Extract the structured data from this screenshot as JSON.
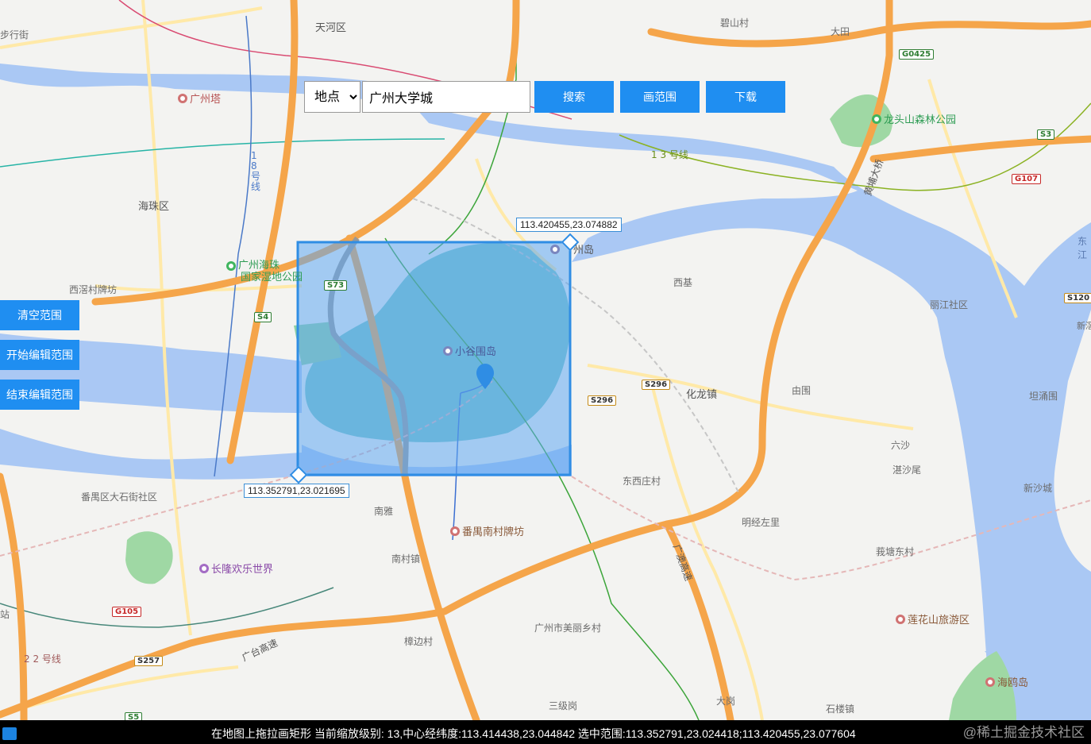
{
  "search": {
    "type_selected": "地点",
    "type_options": [
      "地点"
    ],
    "query_value": "广州大学城",
    "search_label": "搜索",
    "draw_label": "画范围",
    "download_label": "下载"
  },
  "side_buttons": {
    "clear_label": "清空范围",
    "start_edit_label": "开始编辑范围",
    "end_edit_label": "结束编辑范围"
  },
  "selection": {
    "ne_label": "113.420455,23.074882",
    "sw_label": "113.352791,23.021695"
  },
  "status": {
    "text": "在地图上拖拉画矩形 当前缩放级别: 13,中心经纬度:113.414438,23.044842 选中范围:113.352791,23.024418;113.420455,23.077604",
    "watermark": "@稀土掘金技术社区"
  },
  "map": {
    "places": {
      "tianhe": "天河区",
      "bishancun": "碧山村",
      "datian": "大田",
      "buxingjie": "步行街",
      "haizhu": "海珠区",
      "xiqiao": "西滘村牌坊",
      "xiji": "西基",
      "lijiang": "丽江社区",
      "huachong": "化龙镇",
      "youwei": "由围",
      "tanyong": "坦涌围",
      "liusha": "六沙",
      "zhansha": "湛沙尾",
      "xinshacheng": "新沙城",
      "dongxi": "东西庄村",
      "mingjing": "明经左里",
      "yichang": "莪塘东村",
      "panyu_dashi": "番禺区大石街社区",
      "nanya": "南雅",
      "nancun": "南村镇",
      "zhangbian": "樟边村",
      "meili": "广州市美丽乡村",
      "sanji": "三级岗",
      "dagang": "大岗",
      "shilou": "石楼镇",
      "zhan": "站",
      "nanbu": "新滘"
    },
    "pois": {
      "canton_tower": "广州塔",
      "wetland_1": "广州海珠",
      "wetland_2": "国家湿地公园",
      "xiaoguwei": "小谷围岛",
      "pazhou": "州岛",
      "longtou": "龙头山森林公园",
      "nancun_gate": "番禺南村牌坊",
      "changlong": "长隆欢乐世界",
      "lianhua": "莲花山旅游区",
      "haiou": "海鸥岛"
    },
    "roads": {
      "s73": "S73",
      "s4": "S4",
      "s296a": "S296",
      "s296b": "S296",
      "s3": "S3",
      "g0425": "G0425",
      "g107": "G107",
      "s120": "S120",
      "g105": "G105",
      "s257": "S257",
      "s5": "S5",
      "line13": "1 3 号线",
      "line18": "1 8 号 线",
      "line22": "2 2 号线",
      "huangpu": "黄埔大桥",
      "guangao": "广澳高速",
      "guangtai": "广台高速",
      "dongjiang": "东江"
    },
    "colors": {
      "water": "#a9c8f5",
      "land": "#f3f3f1",
      "highway": "#f5a54a",
      "island": "#79c6c6",
      "selection_fill": "#5ea8f2",
      "selection_border": "#2f8de4"
    }
  }
}
